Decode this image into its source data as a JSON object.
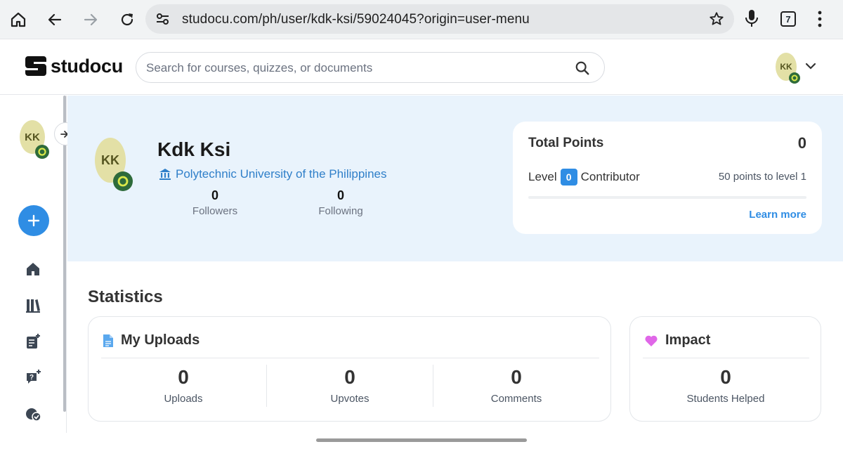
{
  "browser": {
    "url": "studocu.com/ph/user/kdk-ksi/59024045?origin=user-menu",
    "tab_count": "7"
  },
  "header": {
    "logo_text": "studocu",
    "search_placeholder": "Search for courses, quizzes, or documents",
    "avatar_initials": "KK"
  },
  "sidebar": {
    "avatar_initials": "KK",
    "items": [
      "home-icon",
      "library-icon",
      "notes-icon",
      "ask-ai-icon",
      "quiz-icon"
    ]
  },
  "profile": {
    "initials": "KK",
    "name": "Kdk Ksi",
    "university": "Polytechnic University of the Philippines",
    "followers_count": "0",
    "followers_label": "Followers",
    "following_count": "0",
    "following_label": "Following"
  },
  "points": {
    "title": "Total Points",
    "total": "0",
    "level_label": "Level",
    "level": "0",
    "rank": "Contributor",
    "next_level": "50 points to level 1",
    "progress": 0,
    "learn_more": "Learn more"
  },
  "statistics": {
    "title": "Statistics",
    "uploads_card": {
      "title": "My Uploads",
      "metrics": [
        {
          "value": "0",
          "label": "Uploads"
        },
        {
          "value": "0",
          "label": "Upvotes"
        },
        {
          "value": "0",
          "label": "Comments"
        }
      ]
    },
    "impact_card": {
      "title": "Impact",
      "metric": {
        "value": "0",
        "label": "Students Helped"
      }
    }
  },
  "colors": {
    "accent": "#2f8de4",
    "hero_bg": "#e9f3fc",
    "avatar_bg": "#e3e0a6",
    "badge_green": "#2e6b3a",
    "impact_heart": "#e067e8"
  }
}
